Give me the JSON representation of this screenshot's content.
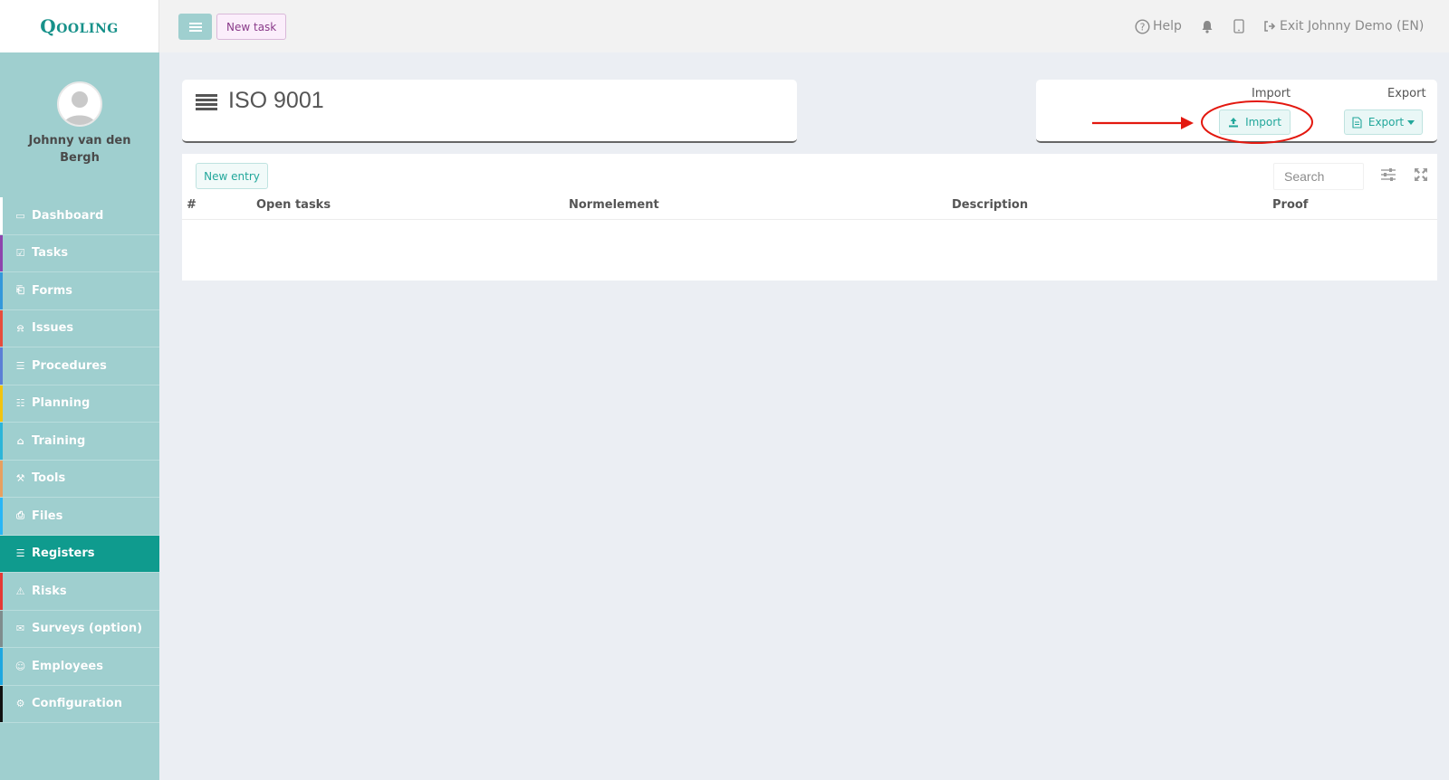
{
  "app": {
    "logo": "Qooling"
  },
  "user": {
    "name": "Johnny van den Bergh"
  },
  "sidebar": {
    "items": [
      {
        "label": "Dashboard",
        "icon": "monitor-icon",
        "stripe": "#ffffff"
      },
      {
        "label": "Tasks",
        "icon": "check-square-icon",
        "stripe": "#8e44ad"
      },
      {
        "label": "Forms",
        "icon": "document-icon",
        "stripe": "#3498db"
      },
      {
        "label": "Issues",
        "icon": "bell-icon",
        "stripe": "#e74c3c"
      },
      {
        "label": "Procedures",
        "icon": "list-alt-icon",
        "stripe": "#5b7fd6"
      },
      {
        "label": "Planning",
        "icon": "calendar-check-icon",
        "stripe": "#f1c40f"
      },
      {
        "label": "Training",
        "icon": "graduation-cap-icon",
        "stripe": "#2db5d8"
      },
      {
        "label": "Tools",
        "icon": "wrench-icon",
        "stripe": "#e8a060"
      },
      {
        "label": "Files",
        "icon": "file-icon",
        "stripe": "#29b6f6"
      },
      {
        "label": "Registers",
        "icon": "list-icon",
        "stripe": "#0f9b8e",
        "active": true
      },
      {
        "label": "Risks",
        "icon": "warning-icon",
        "stripe": "#e53935"
      },
      {
        "label": "Surveys (option)",
        "icon": "chat-icon",
        "stripe": "#7f8c8d"
      },
      {
        "label": "Employees",
        "icon": "users-icon",
        "stripe": "#1ea7e0"
      },
      {
        "label": "Configuration",
        "icon": "gear-icon",
        "stripe": "#111111"
      }
    ]
  },
  "topbar": {
    "new_task_label": "New task",
    "help_label": "Help",
    "exit_label": "Exit Johnny Demo (EN)"
  },
  "page": {
    "title": "ISO 9001"
  },
  "import_export": {
    "import_heading": "Import",
    "export_heading": "Export",
    "import_button": "Import",
    "export_button": "Export"
  },
  "table": {
    "new_entry_label": "New entry",
    "search_placeholder": "Search",
    "columns": [
      "#",
      "Open tasks",
      "Normelement",
      "Description",
      "Proof"
    ]
  },
  "colors": {
    "brand": "#17918a",
    "sidebar_bg": "#9fcfcf",
    "active_item": "#0f9b8e",
    "annotation": "#e3180f"
  }
}
